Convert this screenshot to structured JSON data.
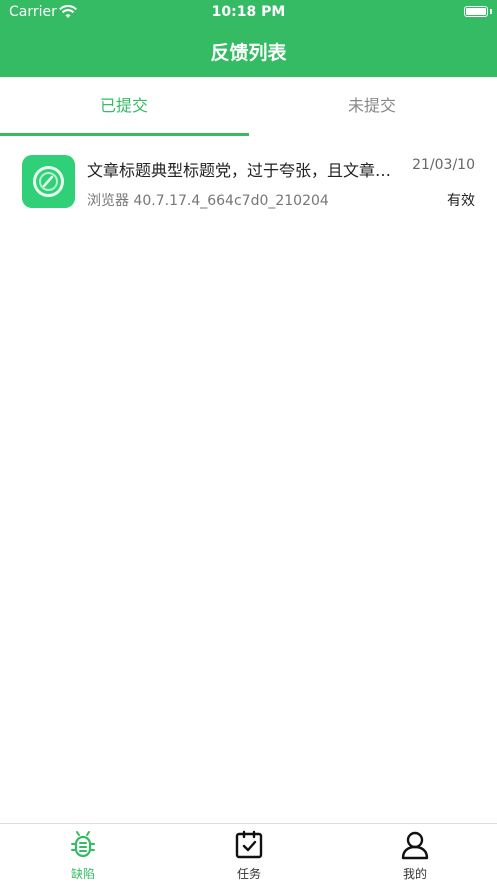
{
  "status_bar": {
    "carrier": "Carrier",
    "time": "10:18 PM"
  },
  "nav": {
    "title": "反馈列表"
  },
  "tabs": [
    {
      "label": "已提交",
      "active": true
    },
    {
      "label": "未提交",
      "active": false
    }
  ],
  "feedback_items": [
    {
      "title": "文章标题典型标题党，过于夸张，且文章内容与标题不符",
      "date": "21/03/10",
      "version": "浏览器 40.7.17.4_664c7d0_210204",
      "status": "有效",
      "icon": "browser-app-icon"
    }
  ],
  "tabbar": [
    {
      "label": "缺陷",
      "icon": "bug-icon",
      "active": true
    },
    {
      "label": "任务",
      "icon": "task-clipboard-icon",
      "active": false
    },
    {
      "label": "我的",
      "icon": "user-icon",
      "active": false
    }
  ],
  "colors": {
    "accent": "#35bb64",
    "app_icon": "#2fd078"
  }
}
